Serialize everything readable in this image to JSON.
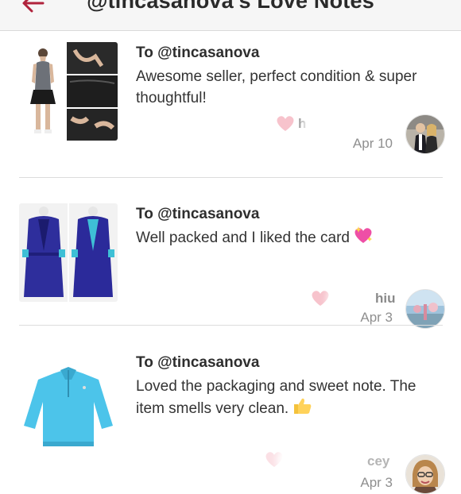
{
  "header": {
    "title": "@tincasanova's Love Notes",
    "back_icon": "back-arrow-icon",
    "accent": "#b0233c"
  },
  "notes": [
    {
      "to": "To @tincasanova",
      "message": "Awesome seller, perfect condition & super thoughtful!",
      "sender_partial": "h                 7",
      "date": "Apr 10",
      "item": "black skort and grey tank outfit"
    },
    {
      "to": "To @tincasanova",
      "message": "Well packed and I liked the card",
      "emoji": "sparkling-heart-icon",
      "sender_partial": "hiu",
      "date": "Apr 3",
      "item": "blue robe"
    },
    {
      "to": "To @tincasanova",
      "message": "Loved the packaging and sweet note. The item smells very clean.",
      "emoji": "thumbs-up-icon",
      "sender_partial": "cey",
      "date": "Apr 3",
      "item": "light blue fleece pullover"
    }
  ],
  "colors": {
    "heart": "#f7c3cc",
    "divider": "#dcdcdc",
    "text": "#333333",
    "muted": "#8f8f8f"
  }
}
